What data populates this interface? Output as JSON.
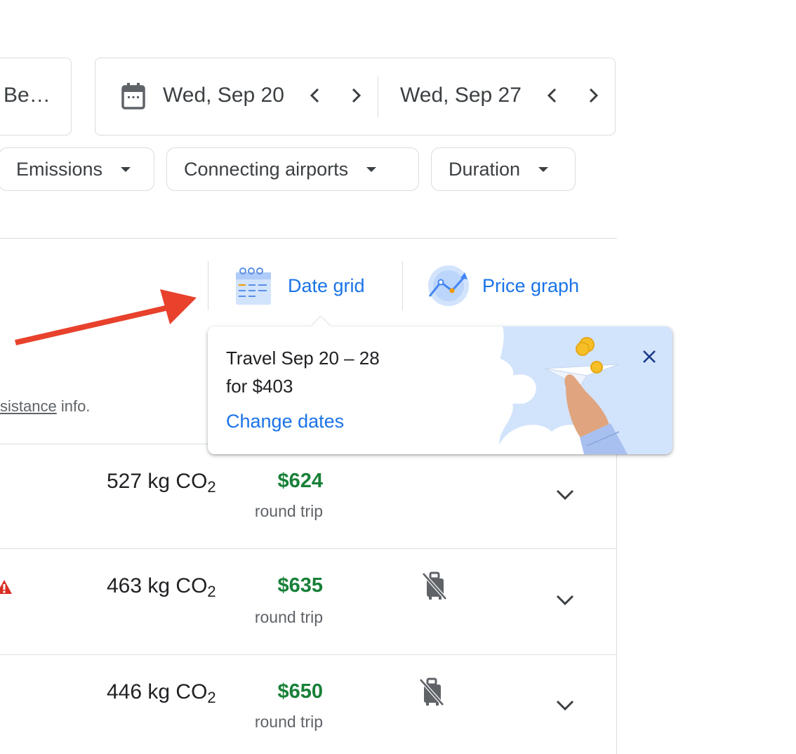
{
  "search": {
    "destination": "Be…",
    "depart_date": "Wed, Sep 20",
    "return_date": "Wed, Sep 27"
  },
  "filters": [
    {
      "label": "Emissions"
    },
    {
      "label": "Connecting airports"
    },
    {
      "label": "Duration"
    }
  ],
  "tools": {
    "date_grid": "Date grid",
    "price_graph": "Price graph"
  },
  "tooltip": {
    "line1": "Travel Sep 20 – 28",
    "line2": "for $403",
    "link": "Change dates"
  },
  "info": {
    "link_text": "sistance",
    "suffix": " info."
  },
  "results": [
    {
      "co2": "527 kg CO",
      "co2_sub": "2",
      "price": "$624",
      "trip": "round trip",
      "no_carry_on": false
    },
    {
      "co2": "463 kg CO",
      "co2_sub": "2",
      "price": "$635",
      "trip": "round trip",
      "no_carry_on": true
    },
    {
      "co2": "446 kg CO",
      "co2_sub": "2",
      "price": "$650",
      "trip": "round trip",
      "no_carry_on": true
    }
  ],
  "colors": {
    "accent": "#1a73e8",
    "price": "#188038",
    "annotation_arrow": "#e8412c",
    "warning": "#d93025"
  }
}
